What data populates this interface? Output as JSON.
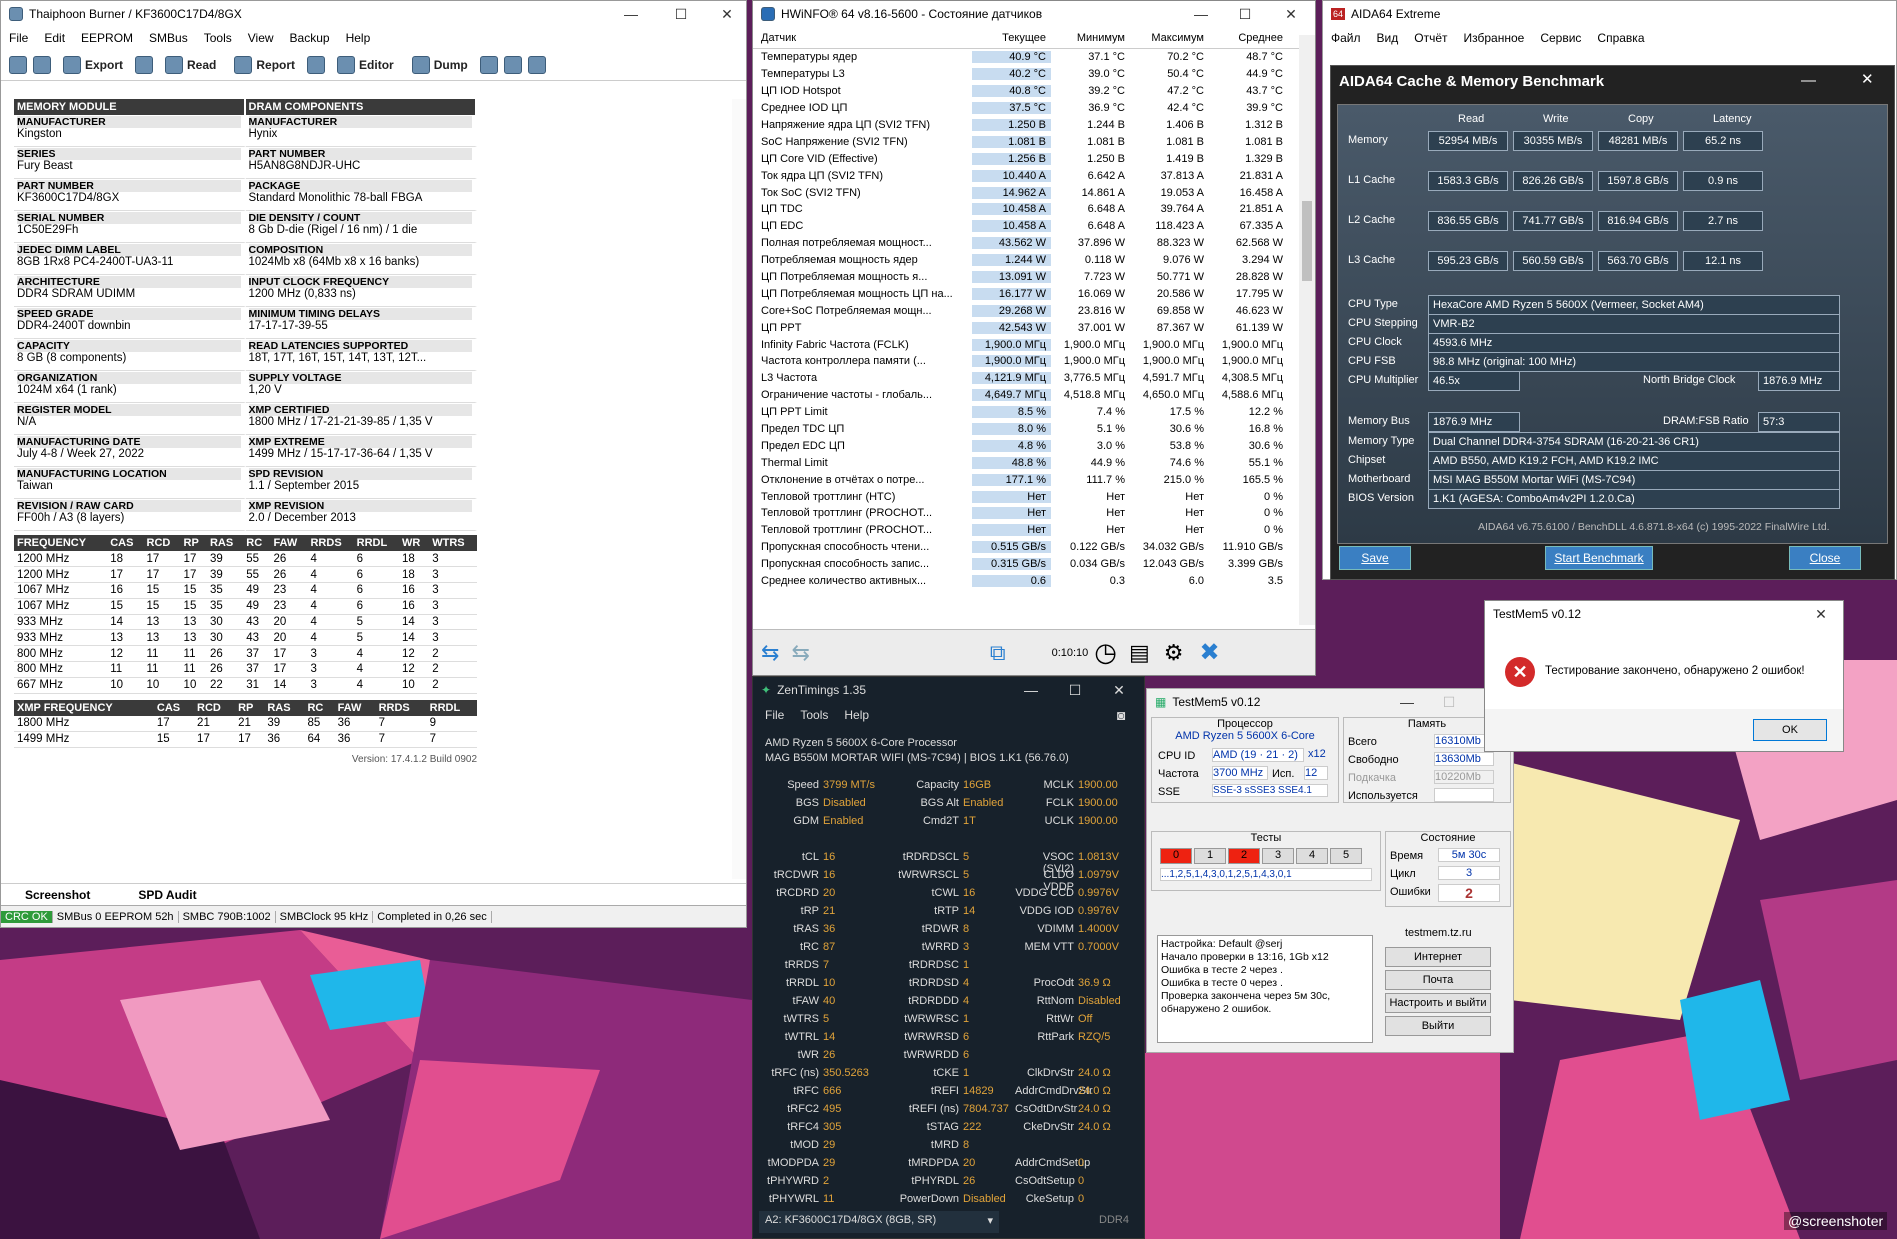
{
  "thaiphoon": {
    "title": "Thaiphoon Burner / KF3600C17D4/8GX",
    "menu": [
      "File",
      "Edit",
      "EEPROM",
      "SMBus",
      "Tools",
      "View",
      "Backup",
      "Help"
    ],
    "toolbar": {
      "export": "Export",
      "read": "Read",
      "report": "Report",
      "editor": "Editor",
      "dump": "Dump"
    },
    "headers": [
      "MEMORY MODULE",
      "DRAM COMPONENTS"
    ],
    "rows": [
      [
        {
          "l": "MANUFACTURER",
          "v": "Kingston"
        },
        {
          "l": "MANUFACTURER",
          "v": "Hynix"
        }
      ],
      [
        {
          "l": "SERIES",
          "v": "Fury Beast"
        },
        {
          "l": "PART NUMBER",
          "v": "H5AN8G8NDJR-UHC"
        }
      ],
      [
        {
          "l": "PART NUMBER",
          "v": "KF3600C17D4/8GX"
        },
        {
          "l": "PACKAGE",
          "v": "Standard Monolithic 78-ball FBGA"
        }
      ],
      [
        {
          "l": "SERIAL NUMBER",
          "v": "1C50E29Fh"
        },
        {
          "l": "DIE DENSITY / COUNT",
          "v": "8 Gb D-die (Rigel / 16 nm) / 1 die"
        }
      ],
      [
        {
          "l": "JEDEC DIMM LABEL",
          "v": "8GB 1Rx8 PC4-2400T-UA3-11"
        },
        {
          "l": "COMPOSITION",
          "v": "1024Mb x8 (64Mb x8 x 16 banks)"
        }
      ],
      [
        {
          "l": "ARCHITECTURE",
          "v": "DDR4 SDRAM UDIMM"
        },
        {
          "l": "INPUT CLOCK FREQUENCY",
          "v": "1200 MHz (0,833 ns)"
        }
      ],
      [
        {
          "l": "SPEED GRADE",
          "v": "DDR4-2400T downbin"
        },
        {
          "l": "MINIMUM TIMING DELAYS",
          "v": "17-17-17-39-55"
        }
      ],
      [
        {
          "l": "CAPACITY",
          "v": "8 GB (8 components)"
        },
        {
          "l": "READ LATENCIES SUPPORTED",
          "v": "18T, 17T, 16T, 15T, 14T, 13T, 12T..."
        }
      ],
      [
        {
          "l": "ORGANIZATION",
          "v": "1024M x64 (1 rank)"
        },
        {
          "l": "SUPPLY VOLTAGE",
          "v": "1,20 V"
        }
      ],
      [
        {
          "l": "REGISTER MODEL",
          "v": "N/A"
        },
        {
          "l": "XMP CERTIFIED",
          "v": "1800 MHz / 17-21-21-39-85 / 1,35 V"
        }
      ],
      [
        {
          "l": "MANUFACTURING DATE",
          "v": "July 4-8 / Week 27, 2022"
        },
        {
          "l": "XMP EXTREME",
          "v": "1499 MHz / 15-17-17-36-64 / 1,35 V"
        }
      ],
      [
        {
          "l": "MANUFACTURING LOCATION",
          "v": "Taiwan"
        },
        {
          "l": "SPD REVISION",
          "v": "1.1 / September 2015"
        }
      ],
      [
        {
          "l": "REVISION / RAW CARD",
          "v": "FF00h / A3 (8 layers)"
        },
        {
          "l": "XMP REVISION",
          "v": "2.0 / December 2013"
        }
      ]
    ],
    "freq_cols": [
      "FREQUENCY",
      "CAS",
      "RCD",
      "RP",
      "RAS",
      "RC",
      "FAW",
      "RRDS",
      "RRDL",
      "WR",
      "WTRS"
    ],
    "freq_rows": [
      [
        "1200 MHz",
        "18",
        "17",
        "17",
        "39",
        "55",
        "26",
        "4",
        "6",
        "18",
        "3"
      ],
      [
        "1200 MHz",
        "17",
        "17",
        "17",
        "39",
        "55",
        "26",
        "4",
        "6",
        "18",
        "3"
      ],
      [
        "1067 MHz",
        "16",
        "15",
        "15",
        "35",
        "49",
        "23",
        "4",
        "6",
        "16",
        "3"
      ],
      [
        "1067 MHz",
        "15",
        "15",
        "15",
        "35",
        "49",
        "23",
        "4",
        "6",
        "16",
        "3"
      ],
      [
        "933 MHz",
        "14",
        "13",
        "13",
        "30",
        "43",
        "20",
        "4",
        "5",
        "14",
        "3"
      ],
      [
        "933 MHz",
        "13",
        "13",
        "13",
        "30",
        "43",
        "20",
        "4",
        "5",
        "14",
        "3"
      ],
      [
        "800 MHz",
        "12",
        "11",
        "11",
        "26",
        "37",
        "17",
        "3",
        "4",
        "12",
        "2"
      ],
      [
        "800 MHz",
        "11",
        "11",
        "11",
        "26",
        "37",
        "17",
        "3",
        "4",
        "12",
        "2"
      ],
      [
        "667 MHz",
        "10",
        "10",
        "10",
        "22",
        "31",
        "14",
        "3",
        "4",
        "10",
        "2"
      ]
    ],
    "xmp_cols": [
      "XMP FREQUENCY",
      "CAS",
      "RCD",
      "RP",
      "RAS",
      "RC",
      "FAW",
      "RRDS",
      "RRDL"
    ],
    "xmp_rows": [
      [
        "1800 MHz",
        "17",
        "21",
        "21",
        "39",
        "85",
        "36",
        "7",
        "9"
      ],
      [
        "1499 MHz",
        "15",
        "17",
        "17",
        "36",
        "64",
        "36",
        "7",
        "7"
      ]
    ],
    "version": "Version: 17.4.1.2 Build 0902",
    "tabs": [
      "Screenshot",
      "SPD Audit"
    ],
    "status": [
      "CRC OK",
      "SMBus 0 EEPROM 52h",
      "SMBC 790B:1002",
      "SMBClock 95 kHz",
      "Completed in 0,26 sec"
    ]
  },
  "hwinfo": {
    "title": "HWiNFO® 64 v8.16-5600 - Состояние датчиков",
    "cols": [
      "Датчик",
      "Текущее",
      "Минимум",
      "Максимум",
      "Среднее"
    ],
    "rows": [
      [
        "Температуры ядер",
        "40.9 °C",
        "37.1 °C",
        "70.2 °C",
        "48.7 °C"
      ],
      [
        "Температуры L3",
        "40.2 °C",
        "39.0 °C",
        "50.4 °C",
        "44.9 °C"
      ],
      [
        "ЦП IOD Hotspot",
        "40.8 °C",
        "39.2 °C",
        "47.2 °C",
        "43.7 °C"
      ],
      [
        "Среднее IOD ЦП",
        "37.5 °C",
        "36.9 °C",
        "42.4 °C",
        "39.9 °C"
      ],
      [
        "Напряжение ядра ЦП (SVI2 TFN)",
        "1.250 В",
        "1.244 В",
        "1.406 В",
        "1.312 В"
      ],
      [
        "SoC Напряжение (SVI2 TFN)",
        "1.081 В",
        "1.081 В",
        "1.081 В",
        "1.081 В"
      ],
      [
        "ЦП Core VID (Effective)",
        "1.256 В",
        "1.250 В",
        "1.419 В",
        "1.329 В"
      ],
      [
        "Ток ядра ЦП (SVI2 TFN)",
        "10.440 A",
        "6.642 A",
        "37.813 A",
        "21.831 A"
      ],
      [
        "Ток SoC (SVI2 TFN)",
        "14.962 A",
        "14.861 A",
        "19.053 A",
        "16.458 A"
      ],
      [
        "ЦП TDC",
        "10.458 A",
        "6.648 A",
        "39.764 A",
        "21.851 A"
      ],
      [
        "ЦП EDC",
        "10.458 A",
        "6.648 A",
        "118.423 A",
        "67.335 A"
      ],
      [
        "Полная потребляемая мощност...",
        "43.562 W",
        "37.896 W",
        "88.323 W",
        "62.568 W"
      ],
      [
        "Потребляемая мощность ядер",
        "1.244 W",
        "0.118 W",
        "9.076 W",
        "3.294 W"
      ],
      [
        "ЦП Потребляемая мощность я...",
        "13.091 W",
        "7.723 W",
        "50.771 W",
        "28.828 W"
      ],
      [
        "ЦП Потребляемая мощность ЦП на...",
        "16.177 W",
        "16.069 W",
        "20.586 W",
        "17.795 W"
      ],
      [
        "Core+SoC Потребляемая мощн...",
        "29.268 W",
        "23.816 W",
        "69.858 W",
        "46.623 W"
      ],
      [
        "ЦП PPT",
        "42.543 W",
        "37.001 W",
        "87.367 W",
        "61.139 W"
      ],
      [
        "Infinity Fabric Частота (FCLK)",
        "1,900.0 МГц",
        "1,900.0 МГц",
        "1,900.0 МГц",
        "1,900.0 МГц"
      ],
      [
        "Частота контроллера памяти (...",
        "1,900.0 МГц",
        "1,900.0 МГц",
        "1,900.0 МГц",
        "1,900.0 МГц"
      ],
      [
        "L3 Частота",
        "4,121.9 МГц",
        "3,776.5 МГц",
        "4,591.7 МГц",
        "4,308.5 МГц"
      ],
      [
        "Ограничение частоты - глобаль...",
        "4,649.7 МГц",
        "4,518.8 МГц",
        "4,650.0 МГц",
        "4,588.6 МГц"
      ],
      [
        "ЦП PPT Limit",
        "8.5 %",
        "7.4 %",
        "17.5 %",
        "12.2 %"
      ],
      [
        "Предел TDC ЦП",
        "8.0 %",
        "5.1 %",
        "30.6 %",
        "16.8 %"
      ],
      [
        "Предел EDC ЦП",
        "4.8 %",
        "3.0 %",
        "53.8 %",
        "30.6 %"
      ],
      [
        "Thermal Limit",
        "48.8 %",
        "44.9 %",
        "74.6 %",
        "55.1 %"
      ],
      [
        "Отклонение в отчётах о потре...",
        "177.1 %",
        "111.7 %",
        "215.0 %",
        "165.5 %"
      ],
      [
        "Тепловой троттлинг (HTC)",
        "Нет",
        "Нет",
        "Нет",
        "0 %"
      ],
      [
        "Тепловой троттлинг (PROCHOT...",
        "Нет",
        "Нет",
        "Нет",
        "0 %"
      ],
      [
        "Тепловой троттлинг (PROCHOT...",
        "Нет",
        "Нет",
        "Нет",
        "0 %"
      ],
      [
        "Пропускная способность чтени...",
        "0.515 GB/s",
        "0.122 GB/s",
        "34.032 GB/s",
        "11.910 GB/s"
      ],
      [
        "Пропускная способность запис...",
        "0.315 GB/s",
        "0.034 GB/s",
        "12.043 GB/s",
        "3.399 GB/s"
      ],
      [
        "Среднее количество активных...",
        "0.6",
        "0.3",
        "6.0",
        "3.5"
      ]
    ],
    "timer": "0:10:10"
  },
  "aida": {
    "outer_title": "AIDA64 Extreme",
    "outer_menu": [
      "Файл",
      "Вид",
      "Отчёт",
      "Избранное",
      "Сервис",
      "Справка"
    ],
    "title": "AIDA64 Cache & Memory Benchmark",
    "cols": [
      "Read",
      "Write",
      "Copy",
      "Latency"
    ],
    "bench": [
      [
        "Memory",
        "52954 MB/s",
        "30355 MB/s",
        "48281 MB/s",
        "65.2 ns"
      ],
      [
        "L1 Cache",
        "1583.3 GB/s",
        "826.26 GB/s",
        "1597.8 GB/s",
        "0.9 ns"
      ],
      [
        "L2 Cache",
        "836.55 GB/s",
        "741.77 GB/s",
        "816.94 GB/s",
        "2.7 ns"
      ],
      [
        "L3 Cache",
        "595.23 GB/s",
        "560.59 GB/s",
        "563.70 GB/s",
        "12.1 ns"
      ]
    ],
    "info": [
      [
        "CPU Type",
        "HexaCore AMD Ryzen 5 5600X (Vermeer, Socket AM4)"
      ],
      [
        "CPU Stepping",
        "VMR-B2"
      ],
      [
        "CPU Clock",
        "4593.6 MHz"
      ],
      [
        "CPU FSB",
        "98.8 MHz (original: 100 MHz)"
      ]
    ],
    "mult_label": "CPU Multiplier",
    "mult": "46.5x",
    "nb_label": "North Bridge Clock",
    "nb": "1876.9 MHz",
    "membus_label": "Memory Bus",
    "membus": "1876.9 MHz",
    "ratio_label": "DRAM:FSB Ratio",
    "ratio": "57:3",
    "info2": [
      [
        "Memory Type",
        "Dual Channel DDR4-3754 SDRAM (16-20-21-36 CR1)"
      ],
      [
        "Chipset",
        "AMD B550, AMD K19.2 FCH, AMD K19.2 IMC"
      ],
      [
        "Motherboard",
        "MSI MAG B550M Mortar WiFi (MS-7C94)"
      ],
      [
        "BIOS Version",
        "1.K1 (AGESA: ComboAm4v2PI 1.2.0.Ca)"
      ]
    ],
    "footer": "AIDA64 v6.75.6100 / BenchDLL 4.6.871.8-x64 (c) 1995-2022 FinalWire Ltd.",
    "save": "Save",
    "start": "Start Benchmark",
    "close": "Close"
  },
  "zen": {
    "title": "ZenTimings 1.35",
    "menu": [
      "File",
      "Tools",
      "Help"
    ],
    "cpu": "AMD Ryzen 5 5600X 6-Core Processor",
    "board": "MAG B550M MORTAR WIFI (MS-7C94) | BIOS 1.K1 (56.76.0)",
    "c1": [
      [
        "Speed",
        "3799 MT/s"
      ],
      [
        "BGS",
        "Disabled"
      ],
      [
        "GDM",
        "Enabled"
      ],
      [
        "",
        ""
      ],
      [
        "tCL",
        "16"
      ],
      [
        "tRCDWR",
        "16"
      ],
      [
        "tRCDRD",
        "20"
      ],
      [
        "tRP",
        "21"
      ],
      [
        "tRAS",
        "36"
      ],
      [
        "tRC",
        "87"
      ],
      [
        "tRRDS",
        "7"
      ],
      [
        "tRRDL",
        "10"
      ],
      [
        "tFAW",
        "40"
      ],
      [
        "tWTRS",
        "5"
      ],
      [
        "tWTRL",
        "14"
      ],
      [
        "tWR",
        "26"
      ],
      [
        "tRFC (ns)",
        "350.5263"
      ],
      [
        "tRFC",
        "666"
      ],
      [
        "tRFC2",
        "495"
      ],
      [
        "tRFC4",
        "305"
      ],
      [
        "tMOD",
        "29"
      ],
      [
        "tMODPDA",
        "29"
      ],
      [
        "tPHYWRD",
        "2"
      ],
      [
        "tPHYWRL",
        "11"
      ]
    ],
    "c2": [
      [
        "Capacity",
        "16GB"
      ],
      [
        "BGS Alt",
        "Enabled"
      ],
      [
        "Cmd2T",
        "1T"
      ],
      [
        "",
        ""
      ],
      [
        "tRDRDSCL",
        "5"
      ],
      [
        "tWRWRSCL",
        "5"
      ],
      [
        "tCWL",
        "16"
      ],
      [
        "tRTP",
        "14"
      ],
      [
        "tRDWR",
        "8"
      ],
      [
        "tWRRD",
        "3"
      ],
      [
        "tRDRDSC",
        "1"
      ],
      [
        "tRDRDSD",
        "4"
      ],
      [
        "tRDRDDD",
        "4"
      ],
      [
        "tWRWRSC",
        "1"
      ],
      [
        "tWRWRSD",
        "6"
      ],
      [
        "tWRWRDD",
        "6"
      ],
      [
        "tCKE",
        "1"
      ],
      [
        "tREFI",
        "14829"
      ],
      [
        "tREFI (ns)",
        "7804.737"
      ],
      [
        "tSTAG",
        "222"
      ],
      [
        "tMRD",
        "8"
      ],
      [
        "tMRDPDA",
        "20"
      ],
      [
        "tPHYRDL",
        "26"
      ],
      [
        "PowerDown",
        "Disabled"
      ]
    ],
    "c3": [
      [
        "MCLK",
        "1900.00"
      ],
      [
        "FCLK",
        "1900.00"
      ],
      [
        "UCLK",
        "1900.00"
      ],
      [
        "",
        ""
      ],
      [
        "VSOC (SVI2)",
        "1.0813V"
      ],
      [
        "CLDO VDDP",
        "1.0979V"
      ],
      [
        "VDDG CCD",
        "0.9976V"
      ],
      [
        "VDDG IOD",
        "0.9976V"
      ],
      [
        "VDIMM",
        "1.4000V"
      ],
      [
        "MEM VTT",
        "0.7000V"
      ],
      [
        "",
        ""
      ],
      [
        "ProcOdt",
        "36.9 Ω"
      ],
      [
        "RttNom",
        "Disabled"
      ],
      [
        "RttWr",
        "Off"
      ],
      [
        "RttPark",
        "RZQ/5"
      ],
      [
        "",
        ""
      ],
      [
        "ClkDrvStr",
        "24.0 Ω"
      ],
      [
        "AddrCmdDrvStr",
        "24.0 Ω"
      ],
      [
        "CsOdtDrvStr",
        "24.0 Ω"
      ],
      [
        "CkeDrvStr",
        "24.0 Ω"
      ],
      [
        "",
        ""
      ],
      [
        "AddrCmdSetup",
        "0"
      ],
      [
        "CsOdtSetup",
        "0"
      ],
      [
        "CkeSetup",
        "0"
      ]
    ],
    "module": "A2: KF3600C17D4/8GX (8GB, SR)",
    "ddr": "DDR4"
  },
  "testmem": {
    "title": "TestMem5 v0.12",
    "cpu_group": "Процессор",
    "cpu": "AMD Ryzen 5 5600X 6-Core",
    "cpuid_label": "CPU ID",
    "cpuid": "AMD  (19 · 21 · 2)",
    "threads": "x12",
    "freq_label": "Частота",
    "freq": "3700 MHz",
    "isp_label": "Исп.",
    "isp": "12",
    "sse_label": "SSE",
    "sse": "SSE-3 sSSE3 SSE4.1",
    "mem_group": "Память",
    "total_label": "Всего",
    "total": "16310Mb",
    "free_label": "Свободно",
    "free": "13630Mb",
    "swap_label": "Подкачка",
    "swap": "10220Mb",
    "used_label": "Используется",
    "tests_group": "Тесты",
    "tests": [
      "0",
      "1",
      "2",
      "3",
      "4",
      "5"
    ],
    "seq": "...1,2,5,1,4,3,0,1,2,5,1,4,3,0,1",
    "state_group": "Состояние",
    "time_label": "Время",
    "time": "5м 30с",
    "cycle_label": "Цикл",
    "cycle": "3",
    "err_label": "Ошибки",
    "err": "2",
    "log": [
      "Настройка: Default @serj",
      "Начало проверки в 13:16, 1Gb x12",
      "Ошибка в тесте 2 через .",
      "Ошибка в тесте 0 через .",
      "Проверка закончена через 5м 30с,",
      "обнаружено 2 ошибок."
    ],
    "site": "testmem.tz.ru",
    "buttons": [
      "Интернет",
      "Почта",
      "Настроить и выйти",
      "Выйти"
    ]
  },
  "dialog": {
    "title": "TestMem5 v0.12",
    "message": "Тестирование закончено, обнаружено 2 ошибок!",
    "ok": "OK"
  },
  "watermark": "@screenshoter"
}
